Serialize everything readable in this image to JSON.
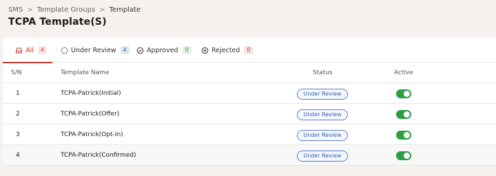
{
  "breadcrumb": {
    "items": [
      "SMS",
      "Template Groups",
      "Template"
    ],
    "separator": ">"
  },
  "page_title": "TCPA Template(S)",
  "tabs": [
    {
      "label": "All",
      "count": "4",
      "icon": "inbox-icon",
      "active": true
    },
    {
      "label": "Under Review",
      "count": "4",
      "icon": "dashed-circle-icon",
      "active": false
    },
    {
      "label": "Approved",
      "count": "0",
      "icon": "check-circle-icon",
      "active": false
    },
    {
      "label": "Rejected",
      "count": "0",
      "icon": "x-circle-icon",
      "active": false
    }
  ],
  "table": {
    "headers": [
      "S/N",
      "Template Name",
      "Status",
      "Active"
    ],
    "rows": [
      {
        "sn": "1",
        "name": "TCPA-Patrick(Initial)",
        "status": "Under Review",
        "active": true
      },
      {
        "sn": "2",
        "name": "TCPA-Patrick(Offer)",
        "status": "Under Review",
        "active": true
      },
      {
        "sn": "3",
        "name": "TCPA-Patrick(Opt-In)",
        "status": "Under Review",
        "active": true
      },
      {
        "sn": "4",
        "name": "TCPA-Patrick(Confirmed)",
        "status": "Under Review",
        "active": true
      }
    ]
  },
  "colors": {
    "accent": "#c0392b",
    "toggle_on": "#2e9e45",
    "status_border": "#5b7fc8",
    "page_background": "#f5f1ee"
  }
}
